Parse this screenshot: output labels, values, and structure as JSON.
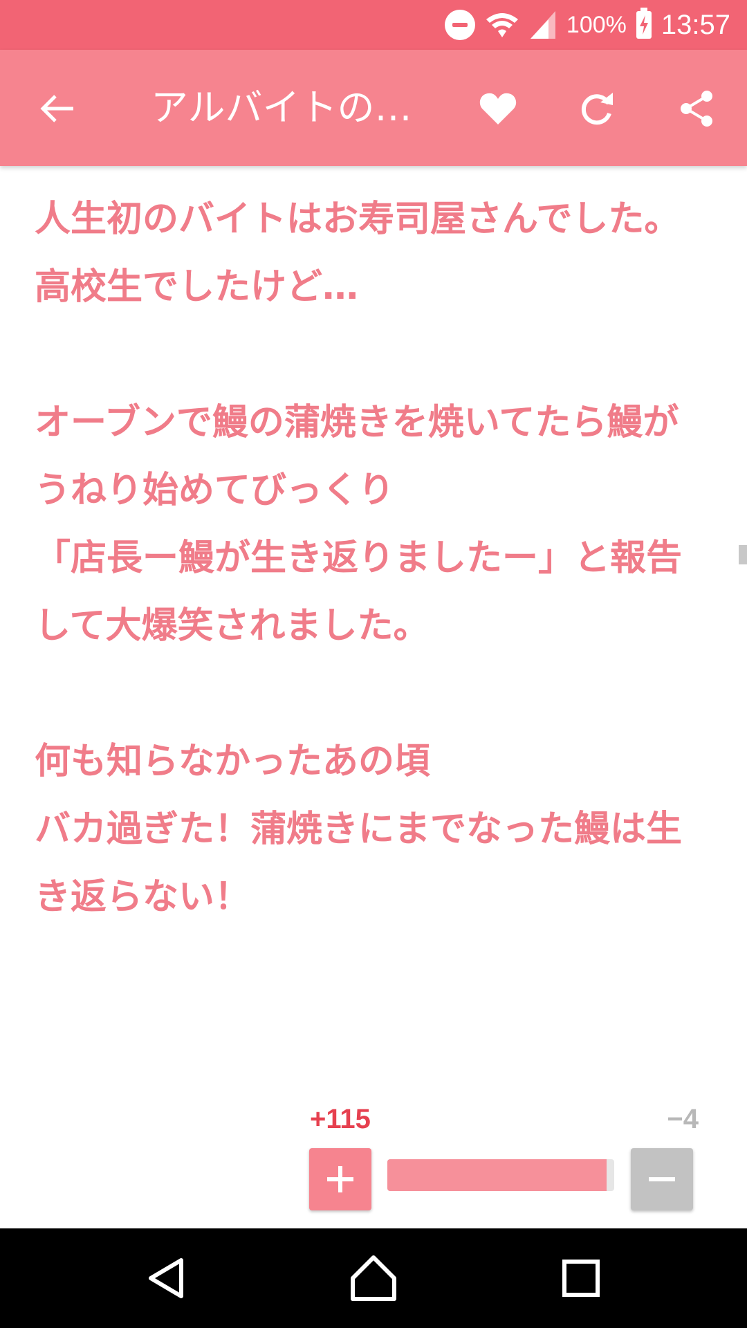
{
  "status_bar": {
    "battery": "100%",
    "time": "13:57",
    "icons": [
      "do-not-disturb-icon",
      "wifi-icon",
      "cell-signal-icon",
      "battery-charging-icon"
    ]
  },
  "app_bar": {
    "title": "アルバイトの…",
    "actions": [
      "back-icon",
      "heart-icon",
      "refresh-icon",
      "share-icon"
    ],
    "background": "#f6848f"
  },
  "article": {
    "text": "人生初のバイトはお寿司屋さんでした。\n高校生でしたけど…\n\nオーブンで鰻の蒲焼きを焼いてたら鰻がうねり始めてびっくり\n「店長ー鰻が生き返りましたー」と報告して大爆笑されました。\n\n何も知らなかったあの頃\nバカ過ぎた！蒲焼きにまでなった鰻は生き返らない！",
    "text_color": "#f07c89"
  },
  "vote": {
    "up_count": "+115",
    "down_count": "−4",
    "up_ratio": 0.966,
    "up_color": "#e6404f",
    "down_color": "#b8b8b8"
  },
  "nav_bar": {
    "buttons": [
      "back-triangle-icon",
      "home-icon",
      "recents-icon"
    ]
  }
}
